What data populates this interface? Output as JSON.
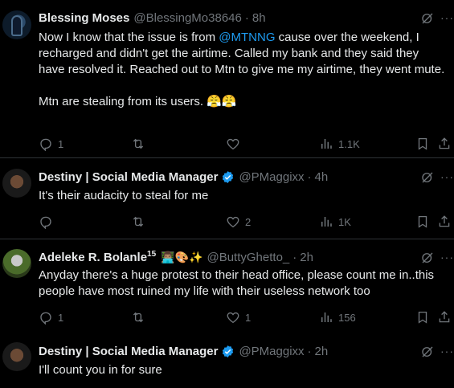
{
  "tweets": [
    {
      "name": "Blessing Moses",
      "handle": "@BlessingMo38646",
      "time": "8h",
      "text_pre": "Now I know that the issue is from ",
      "mention": "@MTNNG",
      "text_post": " cause over the weekend, I recharged and didn't get the airtime. Called my bank and they said they have resolved it. Reached out to Mtn to give me my airtime, they went mute.\n\nMtn are stealing from its users. 😤😤",
      "replies": "1",
      "reposts": "",
      "likes": "",
      "views": "1.1K"
    },
    {
      "name": "Destiny | Social Media Manager",
      "handle": "@PMaggixx",
      "time": "4h",
      "text": "It's their audacity to steal for me",
      "replies": "",
      "reposts": "",
      "likes": "2",
      "views": "1K"
    },
    {
      "name": "Adeleke R. Bolanle",
      "name_sup": "15",
      "name_emojis": "👨🏽‍💻🎨✨",
      "handle": "@ButtyGhetto_",
      "time": "2h",
      "text": "Anyday there's a huge protest to their head office, please count me in..this people have most ruined my life with their useless network too",
      "replies": "1",
      "reposts": "",
      "likes": "1",
      "views": "156"
    },
    {
      "name": "Destiny | Social Media Manager",
      "handle": "@PMaggixx",
      "time": "2h",
      "text": "I'll count you in for sure"
    }
  ],
  "colors": {
    "accent": "#1d9bf0",
    "muted": "#71767b",
    "text": "#e7e9ea",
    "bg": "#000000"
  },
  "icons": [
    "avatar",
    "grok-icon",
    "more-icon",
    "reply-icon",
    "repost-icon",
    "like-icon",
    "views-icon",
    "bookmark-icon",
    "share-icon",
    "verified-badge-icon"
  ]
}
